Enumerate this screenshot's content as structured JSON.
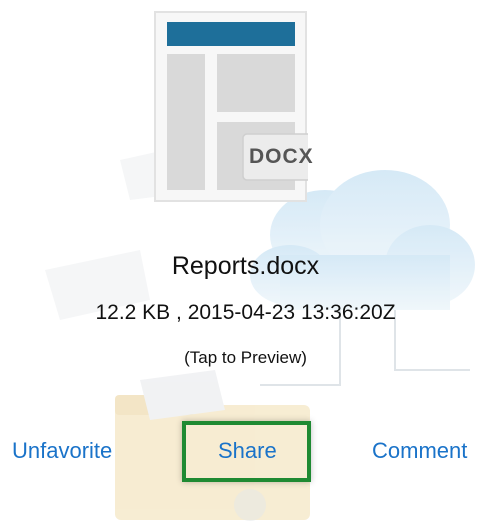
{
  "file": {
    "icon": "docx-document-icon",
    "type_label": "DOCX",
    "name": "Reports.docx",
    "meta": "12.2 KB , 2015-04-23 13:36:20Z",
    "preview_hint": "(Tap to Preview)"
  },
  "actions": {
    "unfavorite": "Unfavorite",
    "share": "Share",
    "comment": "Comment"
  },
  "colors": {
    "action_text": "#1a73c9",
    "doc_header_bar": "#1e6f9a",
    "highlight_border": "#1f8a32"
  }
}
